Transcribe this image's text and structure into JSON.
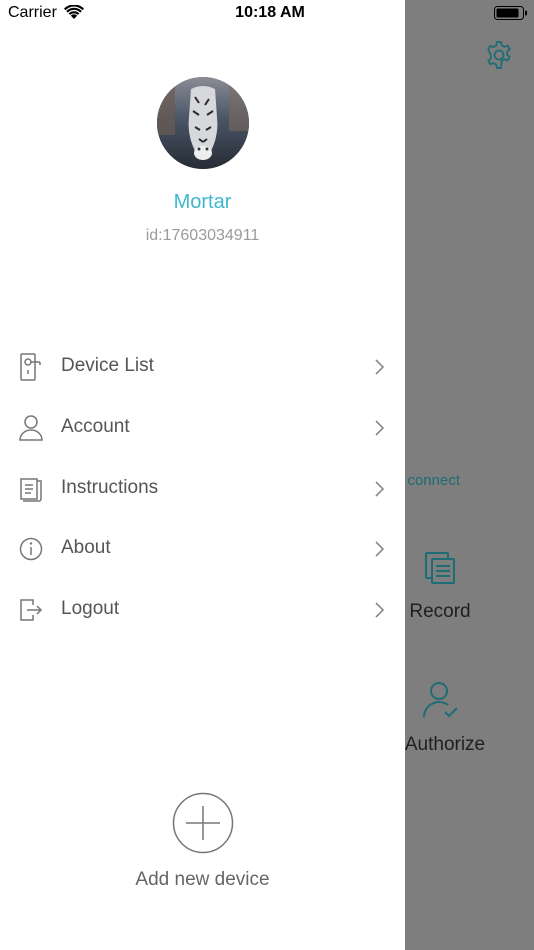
{
  "status_bar": {
    "carrier": "Carrier",
    "time": "10:18 AM"
  },
  "profile": {
    "name": "Mortar",
    "id_text": "id:17603034911"
  },
  "menu": {
    "items": [
      {
        "label": "Device List",
        "icon": "door-lock-icon"
      },
      {
        "label": "Account",
        "icon": "user-icon"
      },
      {
        "label": "Instructions",
        "icon": "document-icon"
      },
      {
        "label": "About",
        "icon": "info-icon"
      },
      {
        "label": "Logout",
        "icon": "logout-icon"
      }
    ]
  },
  "add_device": {
    "label": "Add new device"
  },
  "background_screen": {
    "connect_text": "connect",
    "record_label": "Record",
    "authorize_label": "Authorize"
  },
  "colors": {
    "accent": "#3fb7d0",
    "teal_icon": "#1e6c74",
    "overlay": "#7e7e7e"
  }
}
